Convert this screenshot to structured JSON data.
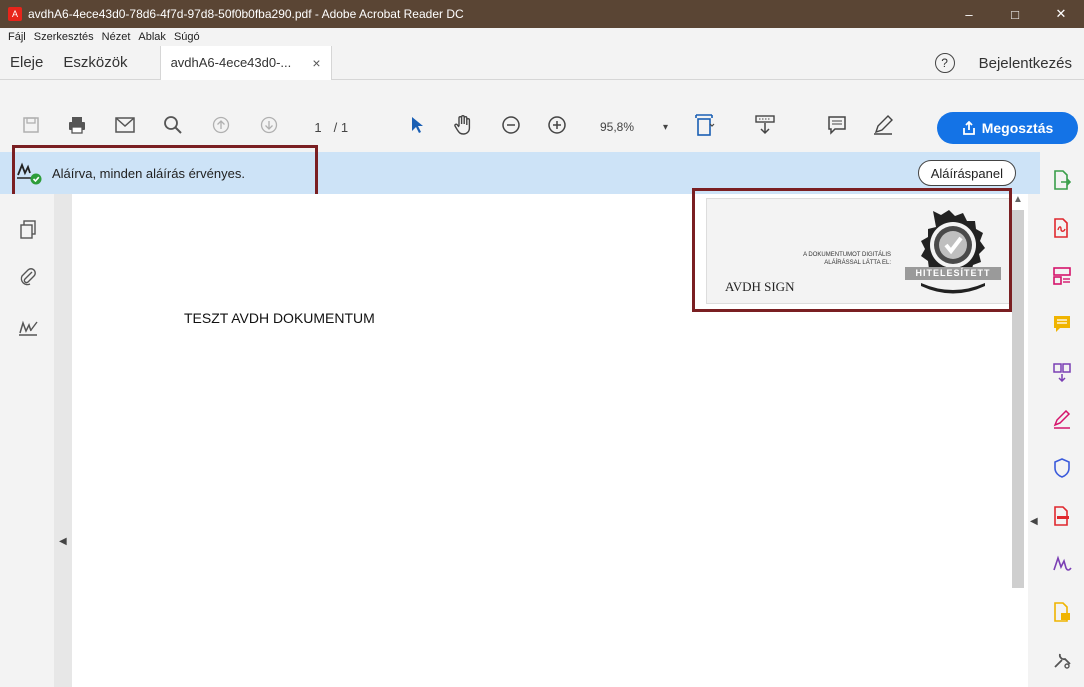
{
  "window": {
    "title": "avdhA6-4ece43d0-78d6-4f7d-97d8-50f0b0fba290.pdf - Adobe Acrobat Reader DC",
    "minimize": "–",
    "maximize": "□",
    "close": "✕"
  },
  "menu": [
    "Fájl",
    "Szerkesztés",
    "Nézet",
    "Ablak",
    "Súgó"
  ],
  "tabs": {
    "home": "Eleje",
    "tools": "Eszközök",
    "doc": "avdhA6-4ece43d0-...",
    "doc_close": "×",
    "help": "?",
    "signin": "Bejelentkezés"
  },
  "toolbar": {
    "page_current": "1",
    "page_total": "/ 1",
    "zoom": "95,8%",
    "zoom_caret": "▾",
    "share_label": "Megosztás"
  },
  "signature_bar": {
    "message": "Aláírva, minden aláírás érvényes.",
    "panel_button": "Aláíráspanel"
  },
  "document": {
    "text": "TESZT AVDH DOKUMENTUM",
    "stamp": {
      "line1": "A DOKUMENTUMOT DIGITÁLIS",
      "line2": "ALÁÍRÁSSAL LÁTTA EL:",
      "name": "AVDH SIGN",
      "seal_banner": "HITELESÍTETT"
    }
  },
  "colors": {
    "titlebar": "#5a4534",
    "accent": "#1473e6",
    "sigbar": "#cde3f7",
    "highlight_box": "#7a1f22"
  }
}
